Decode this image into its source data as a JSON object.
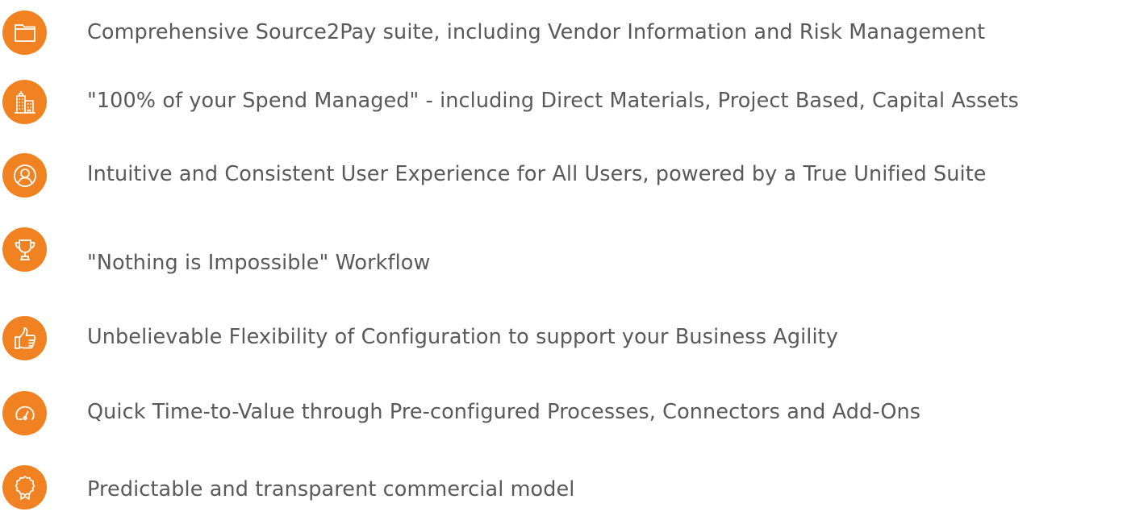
{
  "accent_color": "#f08222",
  "text_color": "#595959",
  "features": [
    {
      "icon": "folder-icon",
      "text": "Comprehensive Source2Pay suite, including Vendor Information and Risk Management"
    },
    {
      "icon": "buildings-icon",
      "text": "\"100% of your Spend Managed\" -  including Direct Materials, Project Based, Capital Assets"
    },
    {
      "icon": "user-icon",
      "text": "Intuitive and Consistent User Experience for All Users, powered by a True Unified Suite"
    },
    {
      "icon": "trophy-icon",
      "text": "\"Nothing is Impossible\" Workflow"
    },
    {
      "icon": "thumbs-up-icon",
      "text": "Unbelievable Flexibility of Configuration to support your Business Agility"
    },
    {
      "icon": "speedometer-icon",
      "text": "Quick Time-to-Value through Pre-configured Processes, Connectors and Add-Ons"
    },
    {
      "icon": "award-ribbon-icon",
      "text": "Predictable and transparent commercial model"
    }
  ]
}
